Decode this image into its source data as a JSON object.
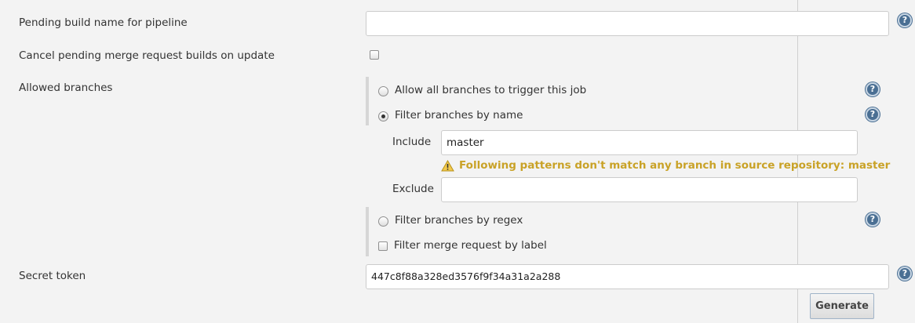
{
  "fields": {
    "pending_build_name": {
      "label": "Pending build name for pipeline",
      "value": ""
    },
    "cancel_pending": {
      "label": "Cancel pending merge request builds on update",
      "checked": false
    },
    "allowed_branches": {
      "label": "Allowed branches",
      "options": [
        {
          "label": "Allow all branches to trigger this job",
          "checked": false
        },
        {
          "label": "Filter branches by name",
          "checked": true
        },
        {
          "label": "Filter branches by regex",
          "checked": false
        }
      ],
      "include": {
        "label": "Include",
        "value": "master"
      },
      "warning": "Following patterns don't match any branch in source repository: master",
      "exclude": {
        "label": "Exclude",
        "value": ""
      },
      "filter_by_label": {
        "label": "Filter merge request by label",
        "checked": false
      }
    },
    "secret_token": {
      "label": "Secret token",
      "value": "447c8f88a328ed3576f9f34a31a2a288"
    }
  },
  "help_glyph": "?",
  "icons": {
    "help": "help-icon",
    "warning": "warning-icon"
  },
  "colors": {
    "warning": "#c9a227",
    "help": "#4a6f93"
  },
  "buttons": {
    "generate": "Generate"
  }
}
